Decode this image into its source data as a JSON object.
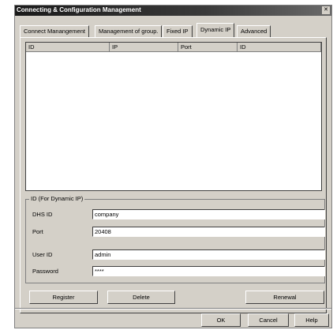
{
  "window": {
    "title": "Connecting & Configuration Management"
  },
  "tabs": [
    {
      "label": "Connect Manangement"
    },
    {
      "label": "Management of group."
    },
    {
      "label": "Fixed IP"
    },
    {
      "label": "Dynamic IP",
      "active": true
    },
    {
      "label": "Advanced"
    }
  ],
  "list": {
    "columns": [
      "ID",
      "IP",
      "Port",
      "ID"
    ]
  },
  "group": {
    "title": "ID (For Dynamic IP)",
    "dhs_id": {
      "label": "DHS ID",
      "value": "company"
    },
    "port": {
      "label": "Port",
      "value": "20408"
    },
    "user_id": {
      "label": "User ID",
      "value": "admin"
    },
    "password": {
      "label": "Password",
      "value": "****"
    }
  },
  "buttons": {
    "register": "Register",
    "delete": "Delete",
    "renewal": "Renewal",
    "ok": "OK",
    "cancel": "Cancel",
    "help": "Help"
  }
}
